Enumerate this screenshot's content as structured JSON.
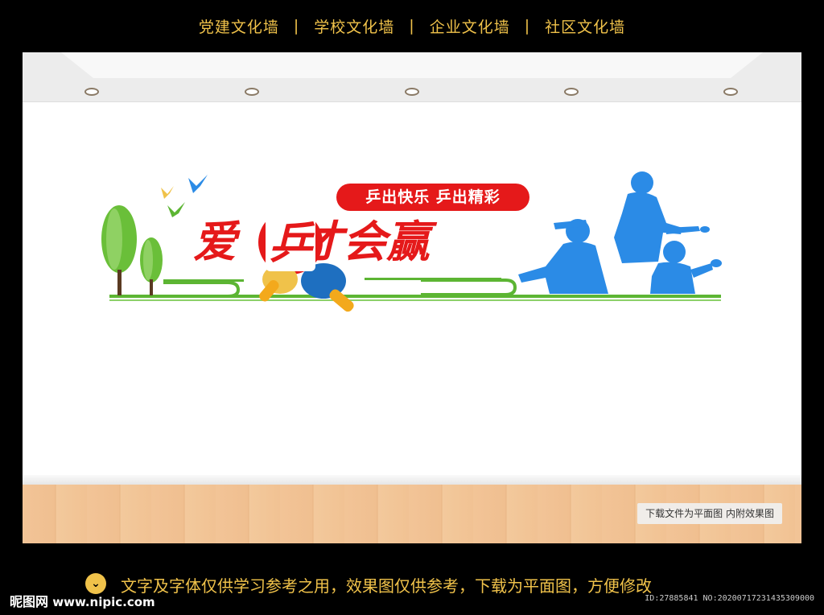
{
  "nav": {
    "items": [
      "党建文化墙",
      "学校文化墙",
      "企业文化墙",
      "社区文化墙"
    ],
    "separator": "|"
  },
  "artwork": {
    "slogan": "乒出快乐 乒出精彩",
    "headline_1": "爱",
    "headline_2": "乒",
    "headline_3": "才会赢"
  },
  "download_note": "下载文件为平面图  内附效果图",
  "notice": "文字及字体仅供学习参考之用，效果图仅供参考，下载为平面图，方便修改",
  "site_logo": {
    "cn": "昵图网",
    "url": "www.nipic.com"
  },
  "image_id": "ID:27885841 NO:20200717231435309000",
  "colors": {
    "red": "#e5191a",
    "blue": "#2b8be6",
    "green": "#5cb533",
    "gold": "#f0c24a"
  }
}
